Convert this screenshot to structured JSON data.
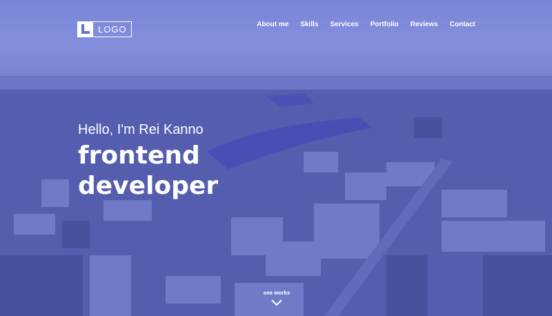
{
  "header": {
    "logo_text": "LOGO",
    "nav": [
      {
        "label": "About me"
      },
      {
        "label": "Skills"
      },
      {
        "label": "Services"
      },
      {
        "label": "Portfolio"
      },
      {
        "label": "Reviews"
      },
      {
        "label": "Contact"
      }
    ]
  },
  "hero": {
    "greeting": "Hello, I'm Rei Kanno",
    "title_line1": "frontend",
    "title_line2": "developer",
    "cta_label": "see works",
    "cta_icon": "chevron-down-icon"
  },
  "colors": {
    "overlay": "#6572cf",
    "text": "#ffffff"
  }
}
